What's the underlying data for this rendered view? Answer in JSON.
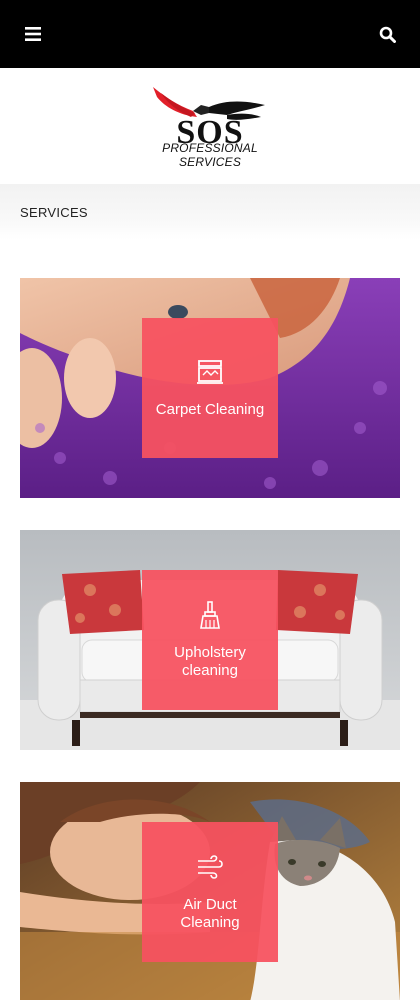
{
  "topbar": {
    "menu_icon": "hamburger-menu-icon",
    "search_icon": "search-icon"
  },
  "logo": {
    "title": "SOS",
    "subtitle": "PROFESSIONAL SERVICES"
  },
  "breadcrumb": {
    "label": "SERVICES"
  },
  "services": [
    {
      "label": "Carpet Cleaning",
      "icon": "carpet-cleaner-icon"
    },
    {
      "label": "Upholstery cleaning",
      "icon": "brush-icon"
    },
    {
      "label": "Air Duct Cleaning",
      "icon": "airflow-icon"
    }
  ],
  "colors": {
    "topbar": "#000000",
    "tile": "#f75260",
    "wing": "#e2202a"
  }
}
